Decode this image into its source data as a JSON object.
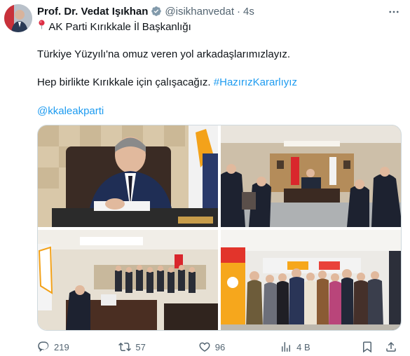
{
  "author": {
    "name": "Prof. Dr. Vedat Işıkhan",
    "handle": "@isikhanvedat",
    "separator": "·",
    "time": "4s"
  },
  "tweet": {
    "location_line": "AK Parti Kırıkkale İl Başkanlığı",
    "line1": "Türkiye Yüzyılı'na omuz veren yol arkadaşlarımızlayız.",
    "line2_text": "Hep birlikte Kırıkkale için çalışacağız.",
    "hashtag": "#HazırızKararlıyız",
    "mention": "@kkaleakparti"
  },
  "stats": {
    "replies": "219",
    "reposts": "57",
    "likes": "96",
    "views": "4 B"
  },
  "icons": {
    "verified": "verified-badge-icon",
    "pin": "round-pushpin-emoji",
    "more": "more-icon",
    "reply": "reply-icon",
    "repost": "repost-icon",
    "like": "heart-icon",
    "views": "views-icon",
    "bookmark": "bookmark-icon",
    "share": "share-icon"
  },
  "colors": {
    "link": "#1d9bf0",
    "secondary_text": "#536471",
    "verified": "#829aab"
  }
}
